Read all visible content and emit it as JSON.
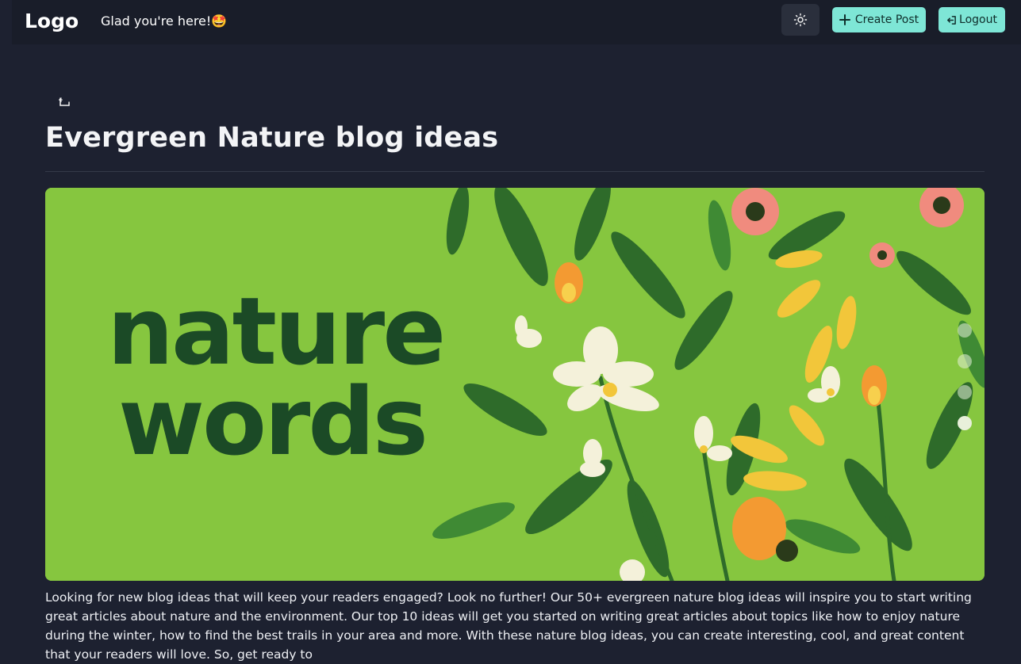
{
  "navbar": {
    "logo": "Logo",
    "greeting": "Glad you're here!🤩",
    "theme_icon": "sun-icon",
    "create_label": "Create Post",
    "create_icon": "plus-icon",
    "logout_label": "Logout",
    "logout_icon": "logout-icon"
  },
  "post": {
    "back_icon": "return-arrow-icon",
    "title": "Evergreen Nature blog ideas",
    "image_text_line1": "nature",
    "image_text_line2": "words",
    "body": "Looking for new blog ideas that will keep your readers engaged? Look no further! Our 50+ evergreen nature blog ideas will inspire you to start writing great articles about nature and the environment. Our top 10 ideas will get you started on writing great articles about topics like how to enjoy nature during the winter, how to find the best trails in your area and more. With these nature blog ideas, you can create interesting, cool, and great content that your readers will love. So, get ready to"
  },
  "colors": {
    "background": "#1d2130",
    "navbar": "#191d29",
    "accent": "#7ee6d6",
    "image_green": "#86c63f",
    "image_text": "#1b4a26"
  }
}
